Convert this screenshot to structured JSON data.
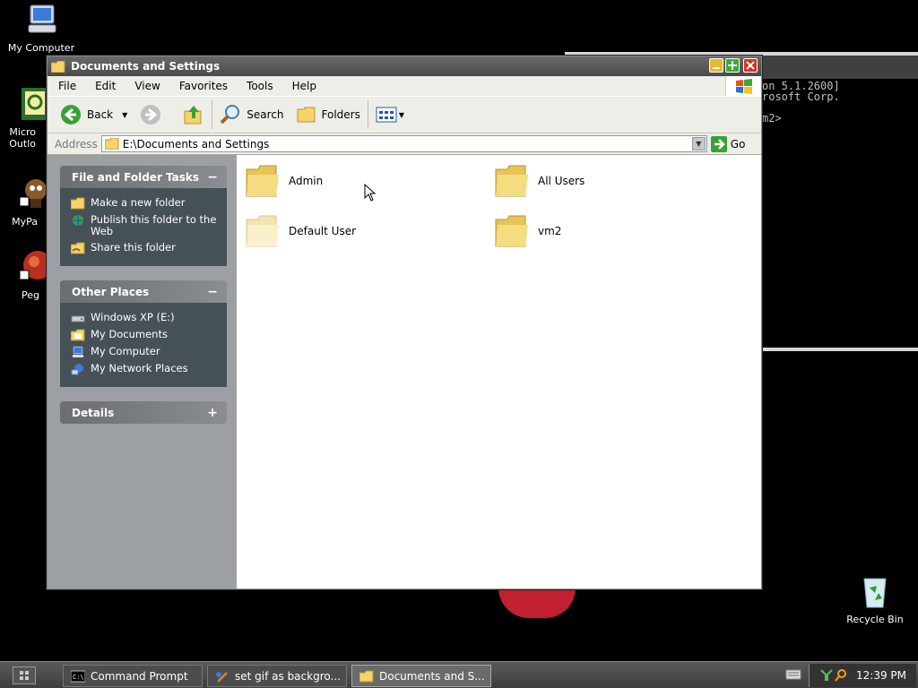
{
  "desktop": {
    "icons": [
      {
        "label": "My Computer"
      },
      {
        "label": "Micro Outlo"
      },
      {
        "label": "MyPa"
      },
      {
        "label": "Peg"
      },
      {
        "label": "Recycle Bin"
      }
    ],
    "console_lines": [
      "on 5.1.2600]",
      "rosoft Corp.",
      "",
      "m2>"
    ]
  },
  "window": {
    "title": "Documents and Settings",
    "menu": [
      "File",
      "Edit",
      "View",
      "Favorites",
      "Tools",
      "Help"
    ],
    "toolbar": {
      "back_label": "Back",
      "search_label": "Search",
      "folders_label": "Folders"
    },
    "address": {
      "label": "Address",
      "value": "E:\\Documents and Settings",
      "go_label": "Go"
    },
    "panels": {
      "file_tasks": {
        "title": "File and Folder Tasks",
        "toggle": "−",
        "items": [
          "Make a new folder",
          "Publish this folder to the Web",
          "Share this folder"
        ]
      },
      "other_places": {
        "title": "Other Places",
        "toggle": "−",
        "items": [
          "Windows XP (E:)",
          "My Documents",
          "My Computer",
          "My Network Places"
        ]
      },
      "details": {
        "title": "Details",
        "toggle": "+"
      }
    },
    "folders": [
      "Admin",
      "All Users",
      "Default User",
      "vm2"
    ]
  },
  "taskbar": {
    "tasks": [
      "Command Prompt",
      "set gif as backgro...",
      "Documents and S..."
    ],
    "clock": "12:39 PM"
  },
  "colors": {
    "panel_body": "#465057",
    "panel_head": "#6a6e72",
    "left_pane": "#9ca0a5",
    "folder_yellow": "#f2d46a"
  }
}
